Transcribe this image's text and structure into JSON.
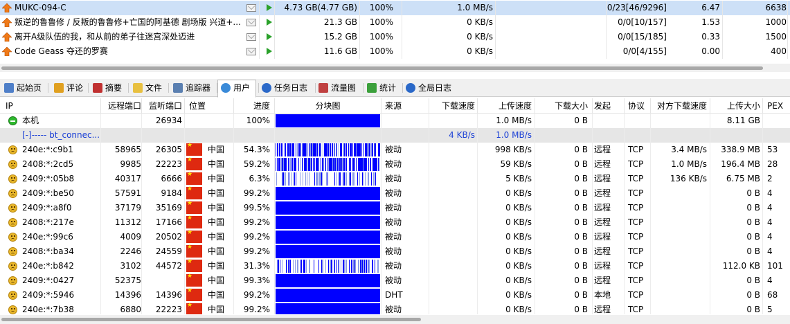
{
  "tasks": [
    {
      "name": "MUKC-094-C",
      "size": "4.73 GB(4.77 GB)",
      "progress": "100%",
      "down_speed": "",
      "up_speed": "1.0 MB/s",
      "peers": "0/23[46/9296]",
      "ratio": "6.47",
      "uploaded": "6638",
      "selected": true
    },
    {
      "name": "叛逆的鲁鲁修 / 反叛的鲁鲁修+亡国的阿基德 剧场版 兴道+...",
      "size": "21.3 GB",
      "progress": "100%",
      "down_speed": "",
      "up_speed": "0 KB/s",
      "peers": "0/0[10/157]",
      "ratio": "1.53",
      "uploaded": "1000",
      "selected": false
    },
    {
      "name": "离开A级队伍的我，和从前的弟子往迷宫深处迈进",
      "size": "15.2 GB",
      "progress": "100%",
      "down_speed": "",
      "up_speed": "0 KB/s",
      "peers": "0/0[15/185]",
      "ratio": "0.33",
      "uploaded": "1500",
      "selected": false
    },
    {
      "name": "Code Geass 夺还的罗赛",
      "size": "11.6 GB",
      "progress": "100%",
      "down_speed": "",
      "up_speed": "0 KB/s",
      "peers": "0/0[4/155]",
      "ratio": "0.00",
      "uploaded": "400",
      "selected": false
    }
  ],
  "tabs": [
    {
      "label": "起始页",
      "icon": "home-page-icon"
    },
    {
      "label": "评论",
      "icon": "comment-icon"
    },
    {
      "label": "摘要",
      "icon": "summary-icon"
    },
    {
      "label": "文件",
      "icon": "file-icon"
    },
    {
      "label": "追踪器",
      "icon": "tracker-icon"
    },
    {
      "label": "用户",
      "icon": "users-icon",
      "active": true
    },
    {
      "label": "任务日志",
      "icon": "task-log-icon"
    },
    {
      "label": "流量图",
      "icon": "traffic-chart-icon"
    },
    {
      "label": "统计",
      "icon": "statistics-icon"
    },
    {
      "label": "全局日志",
      "icon": "global-log-icon"
    }
  ],
  "peer_columns": [
    "IP",
    "远程端口",
    "监听端口",
    "位置",
    "进度",
    "分块图",
    "来源",
    "下载速度",
    "上传速度",
    "下载大小",
    "发起",
    "协议",
    "对方下载速度",
    "上传大小",
    "PEX"
  ],
  "local": {
    "ip": "本机",
    "listen_port": "26934",
    "progress": "100%",
    "up_speed": "1.0 MB/s",
    "down_size": "0 B",
    "up_size": "8.11 GB"
  },
  "group": {
    "label": "[-]----- bt_connec...",
    "down_speed": "4 KB/s",
    "up_speed": "1.0 MB/s"
  },
  "peers": [
    {
      "ip": "240e:*:c9b1",
      "rport": "58965",
      "lport": "26305",
      "loc": "中国",
      "progress": "54.3%",
      "piece": 0.54,
      "source": "被动",
      "up": "998 KB/s",
      "dsize": "0 B",
      "init": "远程",
      "proto": "TCP",
      "peer_down": "3.4 MB/s",
      "usize": "338.9 MB",
      "pex": "53"
    },
    {
      "ip": "2408:*:2cd5",
      "rport": "9985",
      "lport": "22223",
      "loc": "中国",
      "progress": "59.2%",
      "piece": 0.59,
      "source": "被动",
      "up": "59 KB/s",
      "dsize": "0 B",
      "init": "远程",
      "proto": "TCP",
      "peer_down": "1.0 MB/s",
      "usize": "196.4 MB",
      "pex": "28"
    },
    {
      "ip": "2409:*:05b8",
      "rport": "40317",
      "lport": "6666",
      "loc": "中国",
      "progress": "6.3%",
      "piece": 0.06,
      "source": "被动",
      "up": "5 KB/s",
      "dsize": "0 B",
      "init": "远程",
      "proto": "TCP",
      "peer_down": "136 KB/s",
      "usize": "6.75 MB",
      "pex": "2"
    },
    {
      "ip": "2409:*:be50",
      "rport": "57591",
      "lport": "9184",
      "loc": "中国",
      "progress": "99.2%",
      "piece": 0.99,
      "source": "被动",
      "up": "0 KB/s",
      "dsize": "0 B",
      "init": "远程",
      "proto": "TCP",
      "peer_down": "",
      "usize": "0 B",
      "pex": "4"
    },
    {
      "ip": "2409:*:a8f0",
      "rport": "37179",
      "lport": "35169",
      "loc": "中国",
      "progress": "99.5%",
      "piece": 0.995,
      "source": "被动",
      "up": "0 KB/s",
      "dsize": "0 B",
      "init": "远程",
      "proto": "TCP",
      "peer_down": "",
      "usize": "0 B",
      "pex": "4"
    },
    {
      "ip": "2408:*:217e",
      "rport": "11312",
      "lport": "17166",
      "loc": "中国",
      "progress": "99.2%",
      "piece": 0.99,
      "source": "被动",
      "up": "0 KB/s",
      "dsize": "0 B",
      "init": "远程",
      "proto": "TCP",
      "peer_down": "",
      "usize": "0 B",
      "pex": "4"
    },
    {
      "ip": "240e:*:99c6",
      "rport": "4009",
      "lport": "20502",
      "loc": "中国",
      "progress": "99.2%",
      "piece": 0.99,
      "source": "被动",
      "up": "0 KB/s",
      "dsize": "0 B",
      "init": "远程",
      "proto": "TCP",
      "peer_down": "",
      "usize": "0 B",
      "pex": "4"
    },
    {
      "ip": "2408:*:ba34",
      "rport": "2246",
      "lport": "24559",
      "loc": "中国",
      "progress": "99.2%",
      "piece": 0.99,
      "source": "被动",
      "up": "0 KB/s",
      "dsize": "0 B",
      "init": "远程",
      "proto": "TCP",
      "peer_down": "",
      "usize": "0 B",
      "pex": "4"
    },
    {
      "ip": "240e:*:b842",
      "rport": "3102",
      "lport": "44572",
      "loc": "中国",
      "progress": "31.3%",
      "piece": 0.31,
      "source": "被动",
      "up": "0 KB/s",
      "dsize": "0 B",
      "init": "远程",
      "proto": "TCP",
      "peer_down": "",
      "usize": "112.0 KB",
      "pex": "101"
    },
    {
      "ip": "2409:*:0427",
      "rport": "52375",
      "lport": "",
      "loc": "中国",
      "progress": "99.3%",
      "piece": 0.99,
      "source": "被动",
      "up": "0 KB/s",
      "dsize": "0 B",
      "init": "远程",
      "proto": "TCP",
      "peer_down": "",
      "usize": "0 B",
      "pex": "4"
    },
    {
      "ip": "2409:*:5946",
      "rport": "14396",
      "lport": "14396",
      "loc": "中国",
      "progress": "99.2%",
      "piece": 0.99,
      "source": "DHT",
      "up": "0 KB/s",
      "dsize": "0 B",
      "init": "本地",
      "proto": "TCP",
      "peer_down": "",
      "usize": "0 B",
      "pex": "68"
    },
    {
      "ip": "240e:*:7b38",
      "rport": "6880",
      "lport": "22223",
      "loc": "中国",
      "progress": "99.2%",
      "piece": 0.99,
      "source": "被动",
      "up": "0 KB/s",
      "dsize": "0 B",
      "init": "远程",
      "proto": "TCP",
      "peer_down": "",
      "usize": "0 B",
      "pex": "5"
    }
  ],
  "colors": {
    "selected_row": "#cde0f7",
    "piece_fill": "#0000ff",
    "group_text": "#1a3fd6"
  }
}
